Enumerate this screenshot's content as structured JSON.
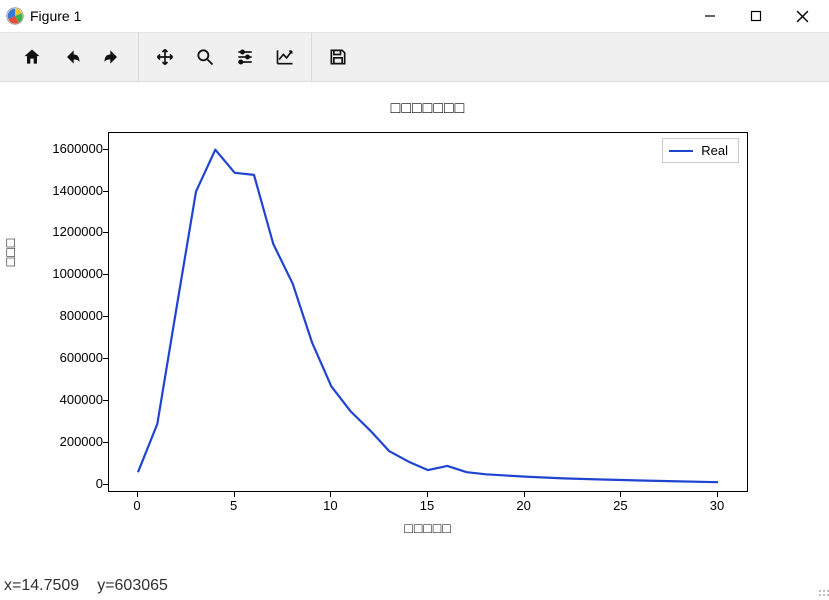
{
  "window": {
    "title": "Figure 1",
    "controls": {
      "minimize_icon": "minimize",
      "maximize_icon": "maximize",
      "close_icon": "close"
    }
  },
  "toolbar": {
    "home": "Home",
    "back": "Back",
    "forward": "Forward",
    "pan": "Pan",
    "zoom": "Zoom",
    "subplots": "Configure subplots",
    "axes_opts": "Edit axis/curve",
    "save": "Save"
  },
  "status": {
    "x_label": "x=",
    "x_value": "14.7509",
    "y_label": "y=",
    "y_value": "603065"
  },
  "chart_data": {
    "type": "line",
    "title": "□□□□□□□",
    "xlabel": "□□□□□",
    "ylabel": "□□□",
    "xlim": [
      -1.5,
      31.5
    ],
    "ylim": [
      -30000,
      1680000
    ],
    "xticks": [
      0,
      5,
      10,
      15,
      20,
      25,
      30
    ],
    "yticks": [
      0,
      200000,
      400000,
      600000,
      800000,
      1000000,
      1200000,
      1400000,
      1600000
    ],
    "legend": [
      "Real"
    ],
    "series": [
      {
        "name": "Real",
        "color": "#1f44d0",
        "x": [
          0,
          1,
          2,
          3,
          4,
          5,
          6,
          7,
          8,
          9,
          10,
          11,
          12,
          13,
          14,
          15,
          16,
          17,
          18,
          20,
          22,
          24,
          26,
          28,
          30
        ],
        "y": [
          60000,
          290000,
          850000,
          1400000,
          1600000,
          1490000,
          1480000,
          1150000,
          960000,
          680000,
          470000,
          350000,
          260000,
          160000,
          110000,
          70000,
          90000,
          60000,
          50000,
          39000,
          30000,
          25000,
          20000,
          16000,
          12000
        ]
      }
    ]
  }
}
